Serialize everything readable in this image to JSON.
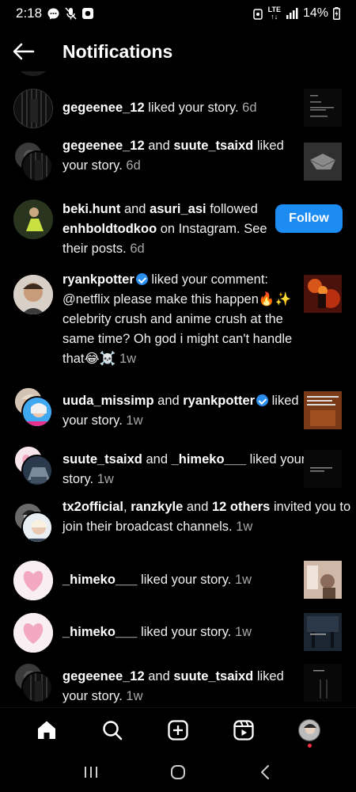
{
  "status": {
    "time": "2:18",
    "network": "LTE",
    "battery": "14%"
  },
  "header": {
    "title": "Notifications"
  },
  "colors": {
    "background": "#000000",
    "accent": "#1d8cf2",
    "verified": "#2a8ef0",
    "muted": "#a8a8a8"
  },
  "notifications": [
    {
      "user": "gegeenee_12",
      "action": "liked your story.",
      "time": "6d"
    },
    {
      "user1": "gegeenee_12",
      "connector": "and",
      "user2": "suute_tsaixd",
      "action": "liked",
      "action2": "your story.",
      "time": "6d"
    },
    {
      "user1": "beki.hunt",
      "connector": "and",
      "user2": "asuri_asi",
      "action": "followed",
      "user3": "enhboldtodkoo",
      "action2": "on Instagram. See",
      "action3": "their posts.",
      "time": "6d",
      "button": "Follow"
    },
    {
      "user": "ryankpotter",
      "action": "liked your comment:",
      "line2": "@netflix please make this happen🔥✨",
      "line3": "celebrity crush and anime crush at the",
      "line4": "same time? Oh god i might can't handle",
      "line5": "that😂☠️",
      "time": "1w"
    },
    {
      "user1": "uuda_missimp",
      "connector": "and",
      "user2": "ryankpotter",
      "action": "liked",
      "action2": "your story.",
      "time": "1w"
    },
    {
      "user1": "suute_tsaixd",
      "connector": "and",
      "user2": "_himeko___",
      "action": "liked your",
      "action2": "story.",
      "time": "1w"
    },
    {
      "user1": "tx2official",
      "sep": ",",
      "user2": "ranzkyle",
      "connector": "and",
      "user3": "12 others",
      "action": "invited you to",
      "action2": "join their broadcast channels.",
      "time": "1w"
    },
    {
      "user": "_himeko___",
      "action": "liked your story.",
      "time": "1w"
    },
    {
      "user": "_himeko___",
      "action": "liked your story.",
      "time": "1w"
    },
    {
      "user1": "gegeenee_12",
      "connector": "and",
      "user2": "suute_tsaixd",
      "action": "liked",
      "action2": "your story.",
      "time": "1w"
    }
  ],
  "nav": {
    "icons": [
      "home-icon",
      "search-icon",
      "create-icon",
      "reels-icon",
      "profile-avatar"
    ]
  },
  "system_nav": {
    "icons": [
      "recents-icon",
      "home-pill-icon",
      "back-icon"
    ]
  }
}
